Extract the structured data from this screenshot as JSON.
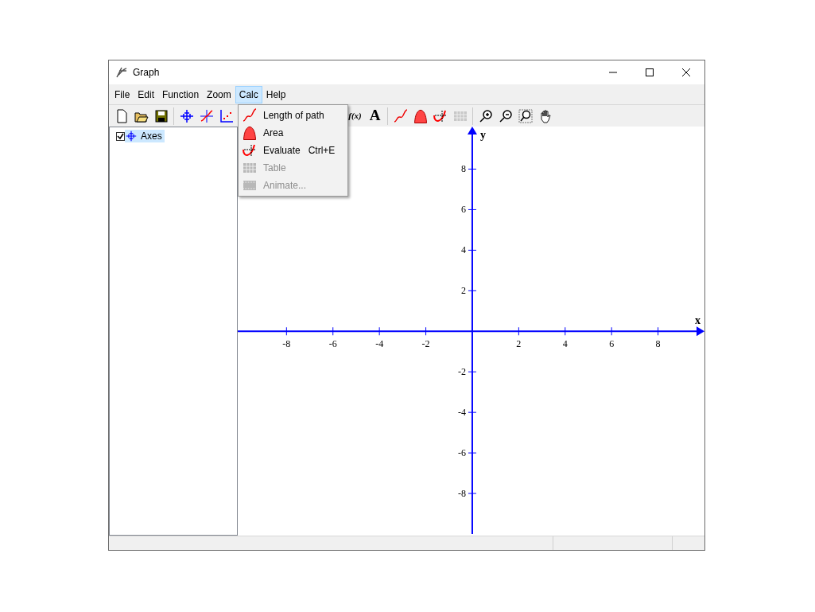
{
  "window": {
    "title": "Graph"
  },
  "menu_bar": [
    {
      "label": "File",
      "selected": false
    },
    {
      "label": "Edit",
      "selected": false
    },
    {
      "label": "Function",
      "selected": false
    },
    {
      "label": "Zoom",
      "selected": false
    },
    {
      "label": "Calc",
      "selected": true
    },
    {
      "label": "Help",
      "selected": false
    }
  ],
  "toolbar": [
    {
      "kind": "new",
      "disabled": false
    },
    {
      "kind": "open",
      "disabled": false
    },
    {
      "kind": "save",
      "disabled": false
    },
    {
      "kind": "separator"
    },
    {
      "kind": "axes",
      "disabled": false
    },
    {
      "kind": "function",
      "disabled": false
    },
    {
      "kind": "points",
      "disabled": false
    },
    {
      "kind": "hidden"
    },
    {
      "kind": "fx",
      "glyph": "f(x)",
      "disabled": false
    },
    {
      "kind": "text",
      "glyph": "A",
      "disabled": false
    },
    {
      "kind": "separator"
    },
    {
      "kind": "path",
      "disabled": false
    },
    {
      "kind": "area",
      "disabled": false
    },
    {
      "kind": "evaluate",
      "disabled": false
    },
    {
      "kind": "table",
      "disabled": true
    },
    {
      "kind": "separator"
    },
    {
      "kind": "zoomin",
      "disabled": false
    },
    {
      "kind": "zoomout",
      "disabled": false
    },
    {
      "kind": "zoomwindow",
      "disabled": false
    },
    {
      "kind": "hand",
      "disabled": false
    }
  ],
  "tree": [
    {
      "label": "Axes",
      "checked": true,
      "selected": true
    }
  ],
  "calc_menu": [
    {
      "kind": "path",
      "label": "Length of path",
      "disabled": false
    },
    {
      "kind": "area",
      "label": "Area",
      "disabled": false
    },
    {
      "kind": "evaluate",
      "label": "Evaluate",
      "shortcut": "Ctrl+E",
      "disabled": false
    },
    {
      "kind": "table",
      "label": "Table",
      "disabled": true
    },
    {
      "kind": "animate",
      "label": "Animate...",
      "disabled": true
    }
  ],
  "graph": {
    "chart_data": {
      "type": "line",
      "xlabel": "x",
      "ylabel": "y",
      "xlim": [
        -10.1,
        10
      ],
      "ylim": [
        -10,
        10.1
      ],
      "xticks": [
        -8,
        -6,
        -4,
        -2,
        2,
        4,
        6,
        8
      ],
      "yticks": [
        -8,
        -6,
        -4,
        -2,
        2,
        4,
        6,
        8
      ]
    }
  }
}
